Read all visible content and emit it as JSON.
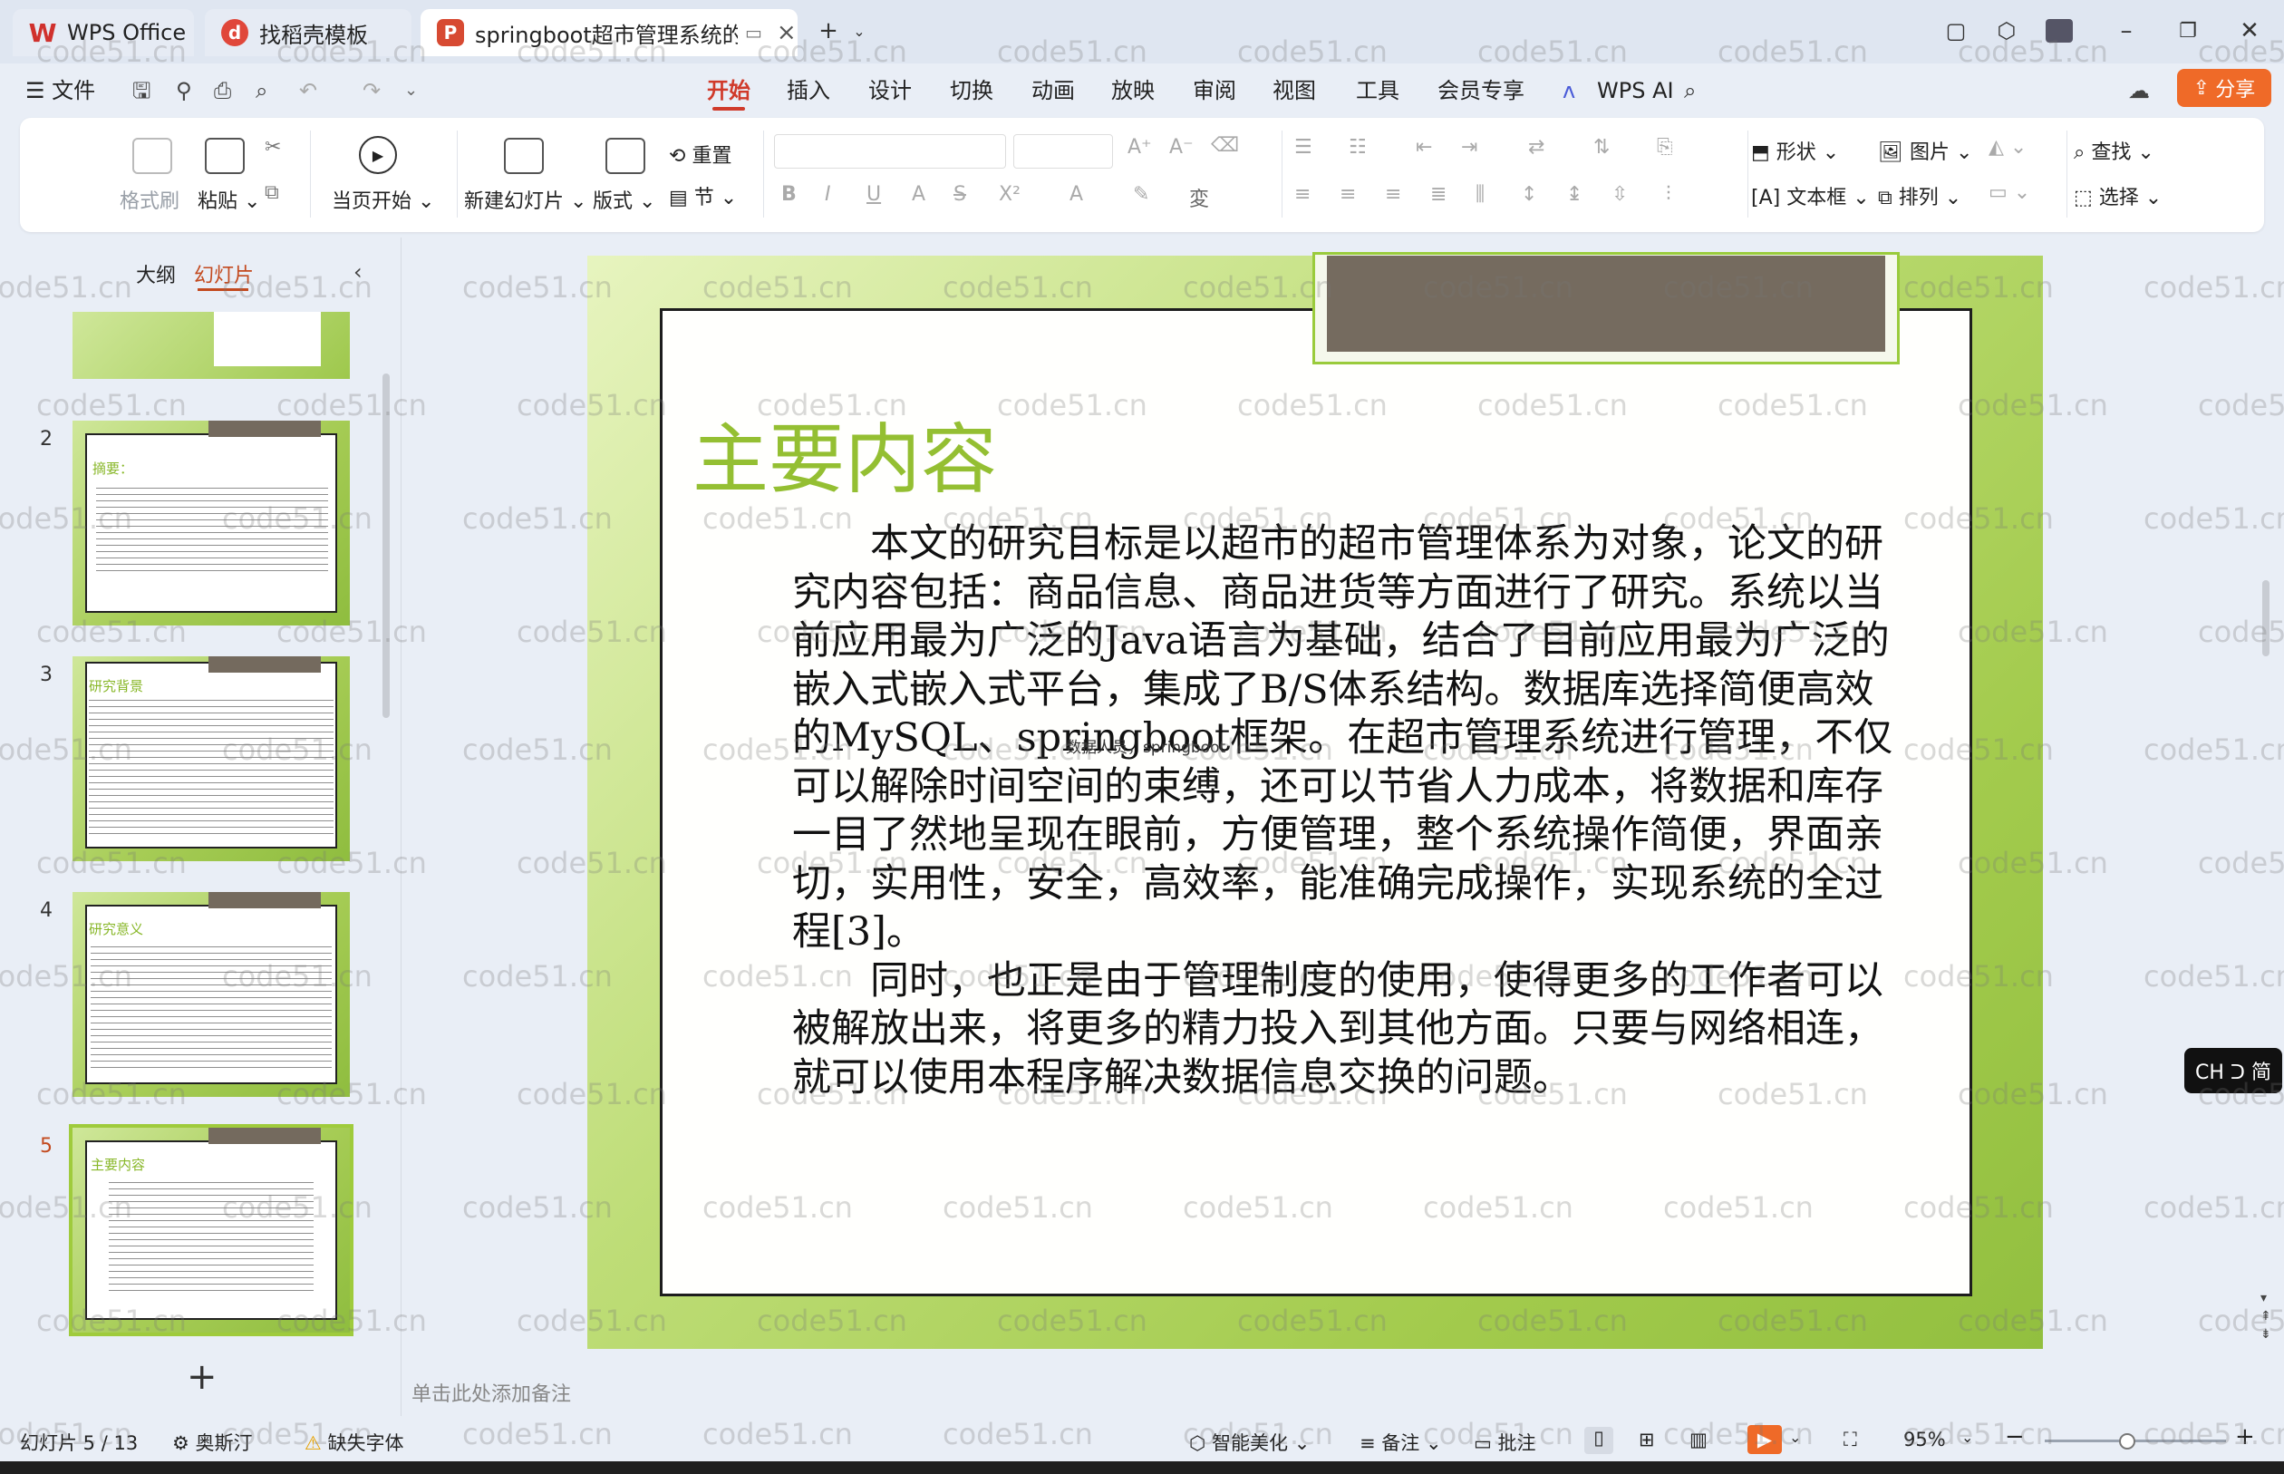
{
  "titlebar": {
    "tabs": [
      {
        "label": "WPS Office"
      },
      {
        "label": "找稻壳模板"
      },
      {
        "label": "springboot超市管理系统的设"
      }
    ]
  },
  "menubar": {
    "file": "文件",
    "tabs": [
      "开始",
      "插入",
      "设计",
      "切换",
      "动画",
      "放映",
      "审阅",
      "视图",
      "工具",
      "会员专享",
      "WPS AI"
    ],
    "share": "分享"
  },
  "ribbon": {
    "format_painter": "格式刷",
    "paste": "粘贴",
    "play_from_current": "当页开始",
    "new_slide": "新建幻灯片",
    "layout": "版式",
    "reset": "重置",
    "section": "节",
    "shape": "形状",
    "picture": "图片",
    "textbox": "文本框",
    "arrange": "排列",
    "find": "查找",
    "select": "选择"
  },
  "leftpane": {
    "tabs": [
      "大纲",
      "幻灯片"
    ],
    "slides": [
      {
        "num": "2",
        "title": "摘要："
      },
      {
        "num": "3",
        "title": "研究背景"
      },
      {
        "num": "4",
        "title": "研究意义"
      },
      {
        "num": "5",
        "title": "主要内容"
      }
    ],
    "add": "+"
  },
  "slide": {
    "title": "主要内容",
    "paragraphs": [
      "本文的研究目标是以超市的超市管理体系为对象，论文的研究内容包括：商品信息、商品进货等方面进行了研究。系统以当前应用最为广泛的Java语言为基础，结合了目前应用最为广泛的嵌入式嵌入式平台，集成了B/S体系结构。数据库选择简便高效的MySQL、springboot框架。在超市管理系统进行管理，不仅可以解除时间空间的束缚，还可以节省人力成本，将数据和库存一目了然地呈现在眼前，方便管理，整个系统操作简便，界面亲切，实用性，安全，高效率，能准确完成操作，实现系统的全过程[3]。",
      "同时，也正是由于管理制度的使用，使得更多的工作者可以被解放出来，将更多的精力投入到其他方面。只要与网络相连，就可以使用本程序解决数据信息交换的问题。"
    ],
    "floating_text": "数据人员，springboot"
  },
  "notes_placeholder": "单击此处添加备注",
  "ime": "CH ᑐ 简",
  "statusbar": {
    "slide_counter": "幻灯片 5 / 13",
    "theme": "奥斯汀",
    "missing_font": "缺失字体",
    "beautify": "智能美化",
    "notes": "备注",
    "comments": "批注",
    "zoom": "95%"
  },
  "watermark": "code51.cn",
  "colors": {
    "accent": "#d03a2a",
    "slide_title": "#94bf32",
    "share_button": "#ef6a28"
  }
}
